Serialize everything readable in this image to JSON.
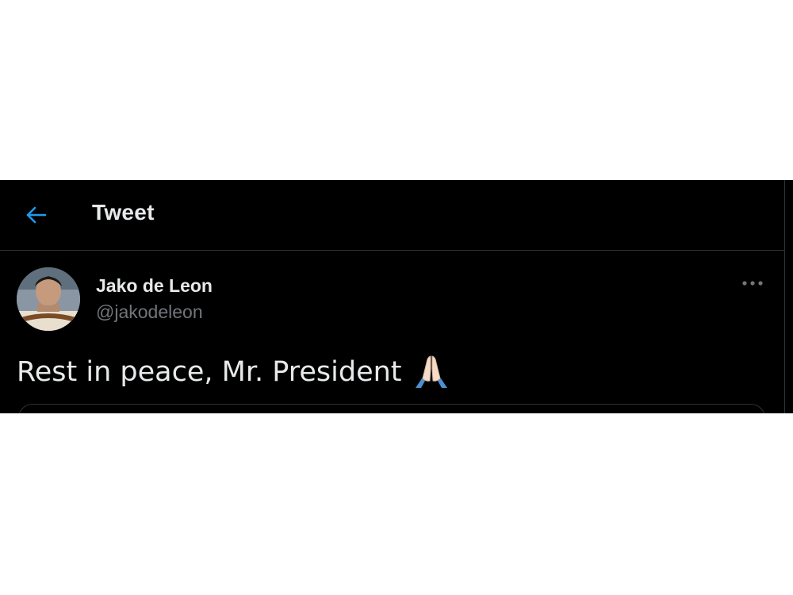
{
  "header": {
    "title": "Tweet",
    "back_icon": "arrow-left-icon",
    "accent_color": "#1d9bf0"
  },
  "tweet": {
    "author": {
      "display_name": "Jako de Leon",
      "handle": "@jakodeleon",
      "avatar_icon": "user-avatar"
    },
    "more_icon": "more-horizontal-icon",
    "text": "Rest in peace, Mr. President",
    "emoji_icon": "folded-hands-icon"
  },
  "colors": {
    "background": "#000000",
    "text_primary": "#e7e9ea",
    "text_secondary": "#71767b",
    "border": "#2f3336"
  }
}
